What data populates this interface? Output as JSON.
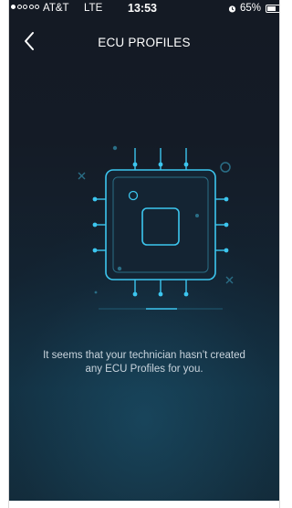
{
  "status_bar": {
    "signal_filled": 1,
    "signal_total": 5,
    "carrier": "AT&T",
    "network": "LTE",
    "time": "13:53",
    "alarm_icon": "alarm-clock-icon",
    "battery_percent": "65%",
    "battery_level": 0.65
  },
  "nav": {
    "back_icon": "chevron-left-icon",
    "title": "ECU PROFILES"
  },
  "empty_state": {
    "illustration_icon": "ecu-chip-icon",
    "message": "It seems that your technician hasn’t created any ECU Profiles for you."
  },
  "colors": {
    "background_top": "#141a24",
    "background_bottom": "#133041",
    "accent": "#3cc6ef",
    "text": "#ffffff",
    "message_text": "#c9d4dd"
  }
}
